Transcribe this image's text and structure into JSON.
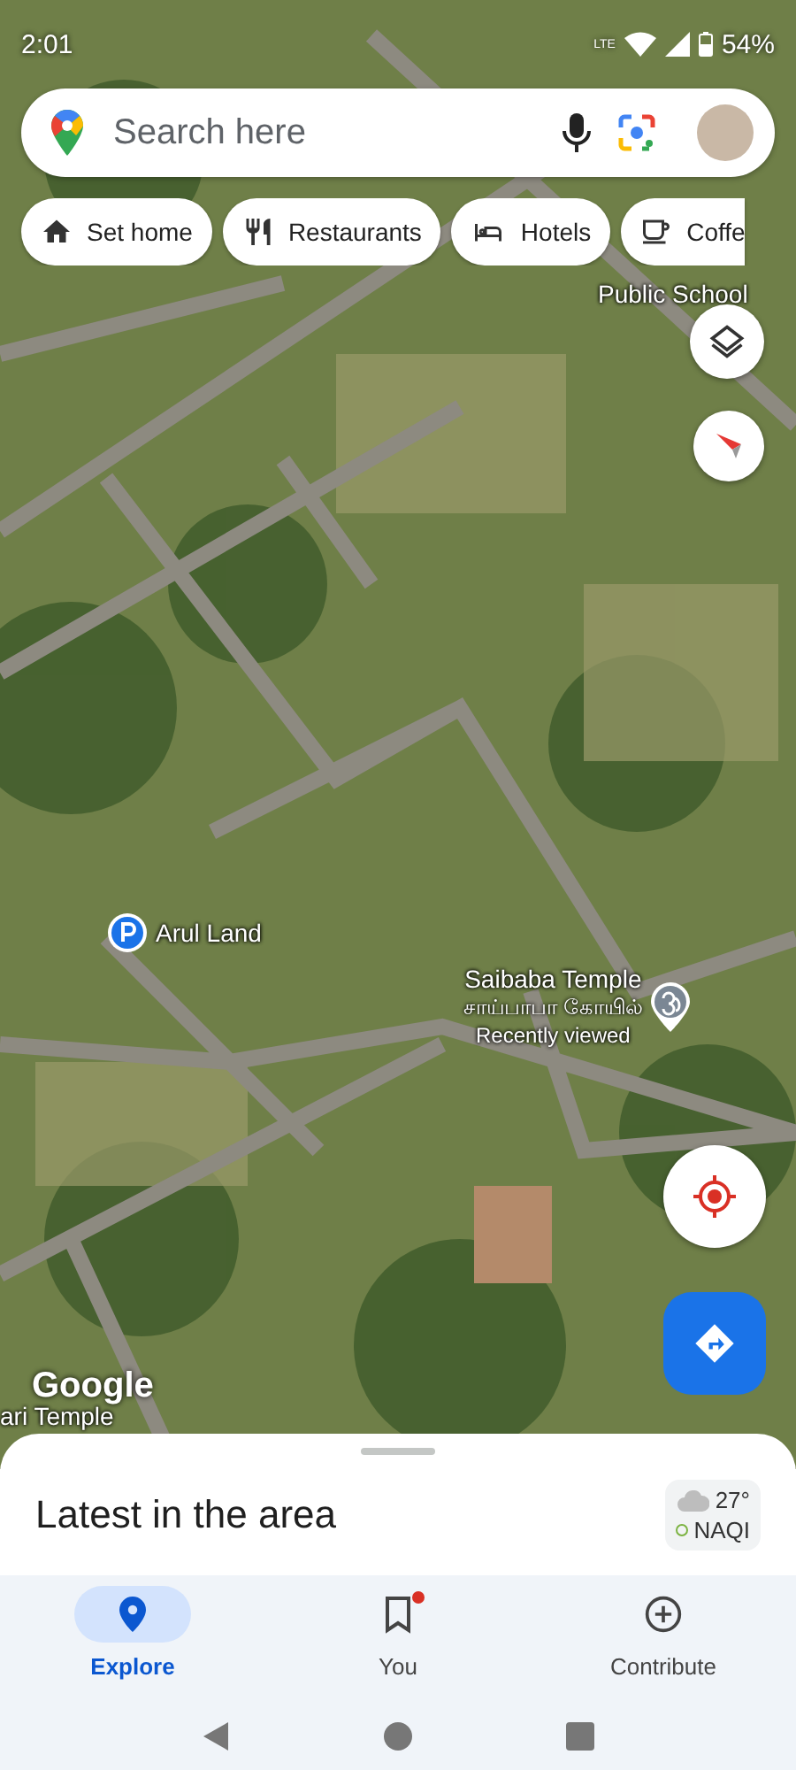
{
  "status_bar": {
    "time": "2:01",
    "network": "LTE",
    "battery": "54%"
  },
  "search": {
    "placeholder": "Search here"
  },
  "chips": [
    {
      "label": "Set home",
      "kind": "home"
    },
    {
      "label": "Restaurants",
      "kind": "restaurant"
    },
    {
      "label": "Hotels",
      "kind": "hotel"
    },
    {
      "label": "Coffe",
      "kind": "coffee"
    }
  ],
  "map": {
    "places": [
      {
        "name": "Public School",
        "kind": "label"
      },
      {
        "name": "Arul Land",
        "kind": "parking"
      },
      {
        "name": "Saibaba Temple",
        "native_name": "சாய்பாபா கோயில்",
        "note": "Recently viewed",
        "kind": "temple"
      },
      {
        "name": "ari Temple",
        "kind": "label"
      }
    ],
    "attribution": "Google"
  },
  "sheet": {
    "title": "Latest in the area",
    "temperature": "27°",
    "air_quality": "NAQI"
  },
  "nav": [
    {
      "label": "Explore",
      "kind": "explore",
      "selected": true,
      "badge": false
    },
    {
      "label": "You",
      "kind": "saved",
      "selected": false,
      "badge": true
    },
    {
      "label": "Contribute",
      "kind": "contribute",
      "selected": false,
      "badge": false
    }
  ]
}
